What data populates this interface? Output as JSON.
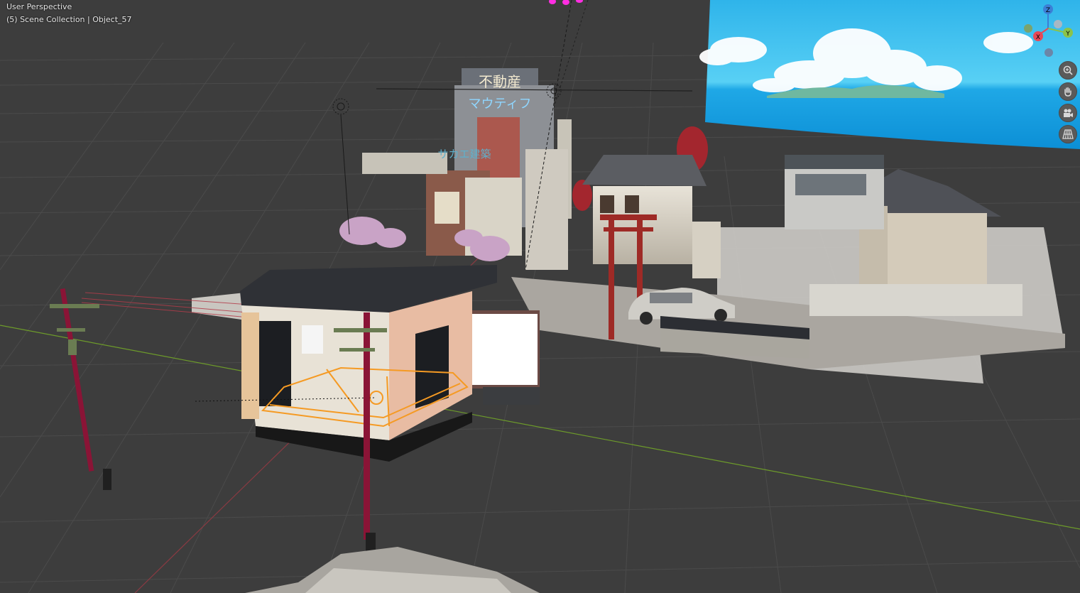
{
  "viewport": {
    "perspective_label": "User Perspective",
    "collection_label": "(5) Scene Collection | Object_57"
  },
  "signs": {
    "real_estate": "不動産",
    "katakana": "マウティフ",
    "sakae": "サカエ建築"
  },
  "gizmo": {
    "z_label": "Z",
    "y_label": "Y",
    "x_label": "X",
    "x_color": "#e84857",
    "y_color": "#8bc34a",
    "z_color": "#3b7fd6"
  },
  "nav_tools": [
    {
      "icon": "zoom-icon"
    },
    {
      "icon": "hand-pan-icon"
    },
    {
      "icon": "camera-icon"
    },
    {
      "icon": "grid-view-icon"
    }
  ],
  "colors": {
    "background": "#3d3d3d",
    "grid": "#4a4a4a",
    "x_axis": "#8a3a42",
    "y_axis": "#6d9b2a",
    "selection": "#f59a23",
    "sky": "#3ec4f0"
  }
}
